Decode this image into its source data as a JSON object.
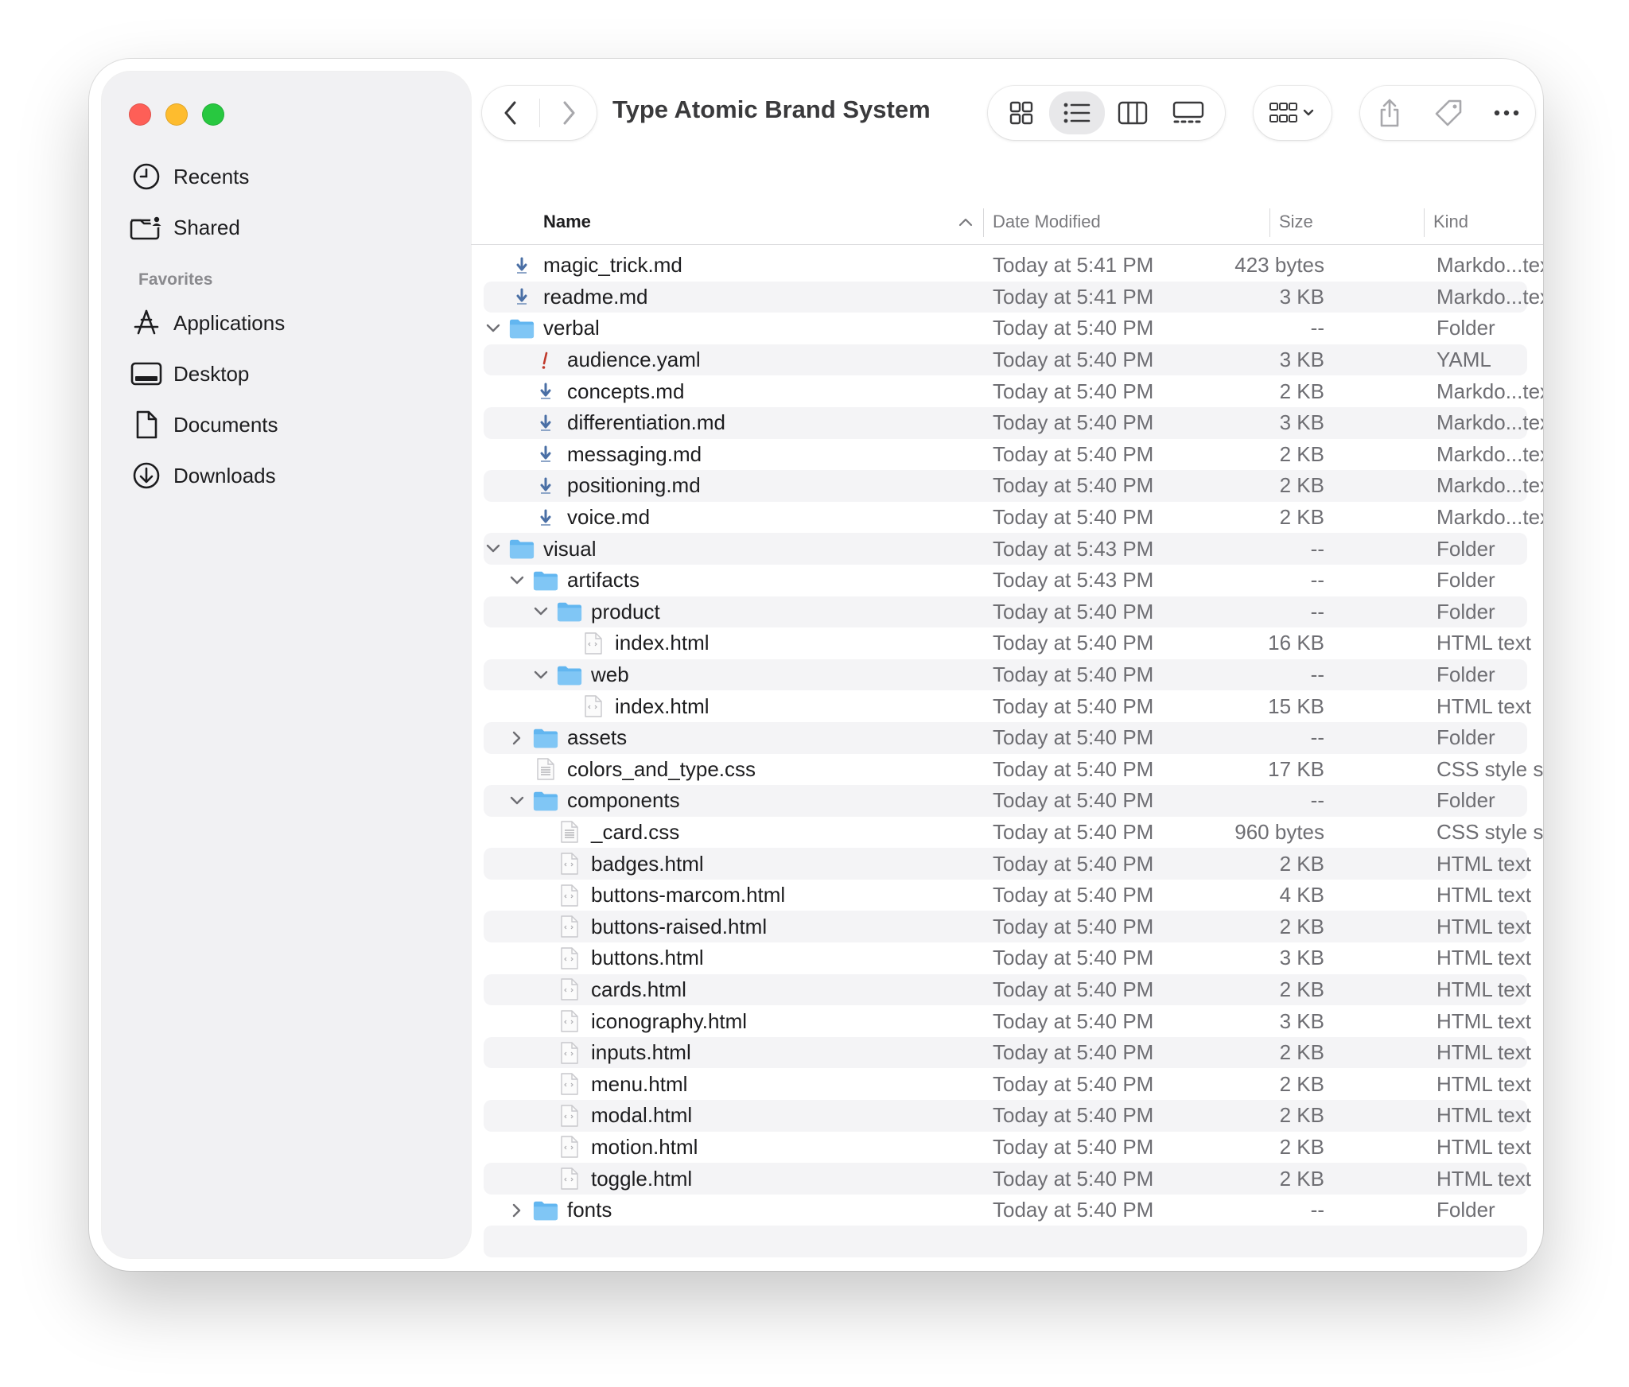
{
  "window": {
    "title": "Type Atomic Brand System"
  },
  "sidebar": {
    "top_items": [
      {
        "label": "Recents",
        "icon": "clock-icon"
      },
      {
        "label": "Shared",
        "icon": "shared-folder-icon"
      }
    ],
    "favorites_title": "Favorites",
    "favorites": [
      {
        "label": "Applications",
        "icon": "applications-icon"
      },
      {
        "label": "Desktop",
        "icon": "desktop-icon"
      },
      {
        "label": "Documents",
        "icon": "document-icon"
      },
      {
        "label": "Downloads",
        "icon": "download-icon"
      }
    ]
  },
  "toolbar": {
    "back": "back-chevron-icon",
    "forward": "forward-chevron-icon",
    "views": [
      "icon-view-icon",
      "list-view-icon",
      "column-view-icon",
      "gallery-view-icon"
    ],
    "active_view": "list-view-icon",
    "group": "group-by-icon",
    "share": "share-icon",
    "tag": "tag-icon",
    "more": "more-icon",
    "search": "search-icon"
  },
  "columns": {
    "name": "Name",
    "date": "Date Modified",
    "size": "Size",
    "kind": "Kind"
  },
  "rows": [
    {
      "name": "magic_trick.md",
      "date": "Today at 5:41 PM",
      "size": "423 bytes",
      "kind": "Markdo...text file",
      "depth": 0,
      "type": "md"
    },
    {
      "name": "readme.md",
      "date": "Today at 5:41 PM",
      "size": "3 KB",
      "kind": "Markdo...text file",
      "depth": 0,
      "type": "md"
    },
    {
      "name": "verbal",
      "date": "Today at 5:40 PM",
      "size": "--",
      "kind": "Folder",
      "depth": 0,
      "type": "folder",
      "expanded": true
    },
    {
      "name": "audience.yaml",
      "date": "Today at 5:40 PM",
      "size": "3 KB",
      "kind": "YAML",
      "depth": 1,
      "type": "yaml"
    },
    {
      "name": "concepts.md",
      "date": "Today at 5:40 PM",
      "size": "2 KB",
      "kind": "Markdo...text file",
      "depth": 1,
      "type": "md"
    },
    {
      "name": "differentiation.md",
      "date": "Today at 5:40 PM",
      "size": "3 KB",
      "kind": "Markdo...text file",
      "depth": 1,
      "type": "md"
    },
    {
      "name": "messaging.md",
      "date": "Today at 5:40 PM",
      "size": "2 KB",
      "kind": "Markdo...text file",
      "depth": 1,
      "type": "md"
    },
    {
      "name": "positioning.md",
      "date": "Today at 5:40 PM",
      "size": "2 KB",
      "kind": "Markdo...text file",
      "depth": 1,
      "type": "md"
    },
    {
      "name": "voice.md",
      "date": "Today at 5:40 PM",
      "size": "2 KB",
      "kind": "Markdo...text file",
      "depth": 1,
      "type": "md"
    },
    {
      "name": "visual",
      "date": "Today at 5:43 PM",
      "size": "--",
      "kind": "Folder",
      "depth": 0,
      "type": "folder",
      "expanded": true
    },
    {
      "name": "artifacts",
      "date": "Today at 5:43 PM",
      "size": "--",
      "kind": "Folder",
      "depth": 1,
      "type": "folder",
      "expanded": true
    },
    {
      "name": "product",
      "date": "Today at 5:40 PM",
      "size": "--",
      "kind": "Folder",
      "depth": 2,
      "type": "folder",
      "expanded": true
    },
    {
      "name": "index.html",
      "date": "Today at 5:40 PM",
      "size": "16 KB",
      "kind": "HTML text",
      "depth": 3,
      "type": "html"
    },
    {
      "name": "web",
      "date": "Today at 5:40 PM",
      "size": "--",
      "kind": "Folder",
      "depth": 2,
      "type": "folder",
      "expanded": true
    },
    {
      "name": "index.html",
      "date": "Today at 5:40 PM",
      "size": "15 KB",
      "kind": "HTML text",
      "depth": 3,
      "type": "html"
    },
    {
      "name": "assets",
      "date": "Today at 5:40 PM",
      "size": "--",
      "kind": "Folder",
      "depth": 1,
      "type": "folder",
      "expanded": false
    },
    {
      "name": "colors_and_type.css",
      "date": "Today at 5:40 PM",
      "size": "17 KB",
      "kind": "CSS style sheet",
      "depth": 1,
      "type": "css"
    },
    {
      "name": "components",
      "date": "Today at 5:40 PM",
      "size": "--",
      "kind": "Folder",
      "depth": 1,
      "type": "folder",
      "expanded": true
    },
    {
      "name": "_card.css",
      "date": "Today at 5:40 PM",
      "size": "960 bytes",
      "kind": "CSS style sheet",
      "depth": 2,
      "type": "css"
    },
    {
      "name": "badges.html",
      "date": "Today at 5:40 PM",
      "size": "2 KB",
      "kind": "HTML text",
      "depth": 2,
      "type": "html"
    },
    {
      "name": "buttons-marcom.html",
      "date": "Today at 5:40 PM",
      "size": "4 KB",
      "kind": "HTML text",
      "depth": 2,
      "type": "html"
    },
    {
      "name": "buttons-raised.html",
      "date": "Today at 5:40 PM",
      "size": "2 KB",
      "kind": "HTML text",
      "depth": 2,
      "type": "html"
    },
    {
      "name": "buttons.html",
      "date": "Today at 5:40 PM",
      "size": "3 KB",
      "kind": "HTML text",
      "depth": 2,
      "type": "html"
    },
    {
      "name": "cards.html",
      "date": "Today at 5:40 PM",
      "size": "2 KB",
      "kind": "HTML text",
      "depth": 2,
      "type": "html"
    },
    {
      "name": "iconography.html",
      "date": "Today at 5:40 PM",
      "size": "3 KB",
      "kind": "HTML text",
      "depth": 2,
      "type": "html"
    },
    {
      "name": "inputs.html",
      "date": "Today at 5:40 PM",
      "size": "2 KB",
      "kind": "HTML text",
      "depth": 2,
      "type": "html"
    },
    {
      "name": "menu.html",
      "date": "Today at 5:40 PM",
      "size": "2 KB",
      "kind": "HTML text",
      "depth": 2,
      "type": "html"
    },
    {
      "name": "modal.html",
      "date": "Today at 5:40 PM",
      "size": "2 KB",
      "kind": "HTML text",
      "depth": 2,
      "type": "html"
    },
    {
      "name": "motion.html",
      "date": "Today at 5:40 PM",
      "size": "2 KB",
      "kind": "HTML text",
      "depth": 2,
      "type": "html"
    },
    {
      "name": "toggle.html",
      "date": "Today at 5:40 PM",
      "size": "2 KB",
      "kind": "HTML text",
      "depth": 2,
      "type": "html"
    },
    {
      "name": "fonts",
      "date": "Today at 5:40 PM",
      "size": "--",
      "kind": "Folder",
      "depth": 1,
      "type": "folder",
      "expanded": false
    }
  ],
  "colors": {
    "folder": "#62b6f0",
    "accent": "#4a6fa5"
  }
}
